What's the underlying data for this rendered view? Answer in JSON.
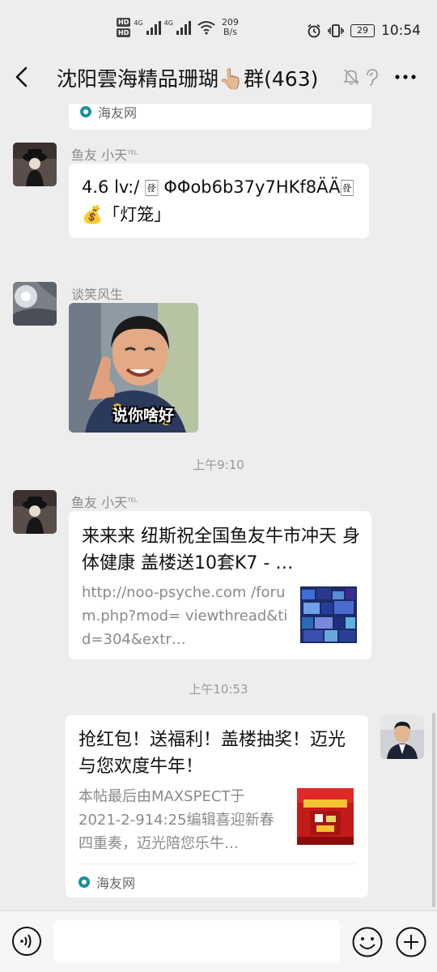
{
  "status_bar": {
    "hd1": "HD",
    "hd2": "HD",
    "net1": "4G",
    "net2": "4G",
    "speed_value": "209",
    "speed_unit": "B/s",
    "battery": "29",
    "time": "10:54"
  },
  "header": {
    "title": "沈阳雲海精品珊瑚👆🏼群(463)"
  },
  "messages": {
    "partial_site": "海友网",
    "msg1": {
      "sender": "鱼友 小天",
      "sender_tag": "TEL",
      "text": "4.6 lv:/ 🀅 ΦΦob6b37y7HKf8ÄÄ🀅💰「灯笼」"
    },
    "msg2": {
      "sender": "谈笑风生",
      "sticker_caption": "说你啥好"
    },
    "time1": "上午9:10",
    "msg3": {
      "sender": "鱼友 小天",
      "sender_tag": "TEL",
      "link_title": "来来来 纽斯祝全国鱼友牛市冲天 身体健康 盖楼送10套K7 - …",
      "link_desc": "http://noo-psyche.com /forum.php?mod= viewthread&tid=304&extr…"
    },
    "time2": "上午10:53",
    "msg4": {
      "link_title": "抢红包！送福利！盖楼抽奖！迈光与您欢度牛年！",
      "link_desc": "本帖最后由MAXSPECT于2021-2-914:25编辑喜迎新春四重奏，迈光陪您乐牛…",
      "site": "海友网"
    }
  },
  "input": {
    "placeholder": ""
  },
  "colors": {
    "background": "#ededed",
    "bubble": "#ffffff",
    "secondary_text": "#8a8a8a"
  }
}
